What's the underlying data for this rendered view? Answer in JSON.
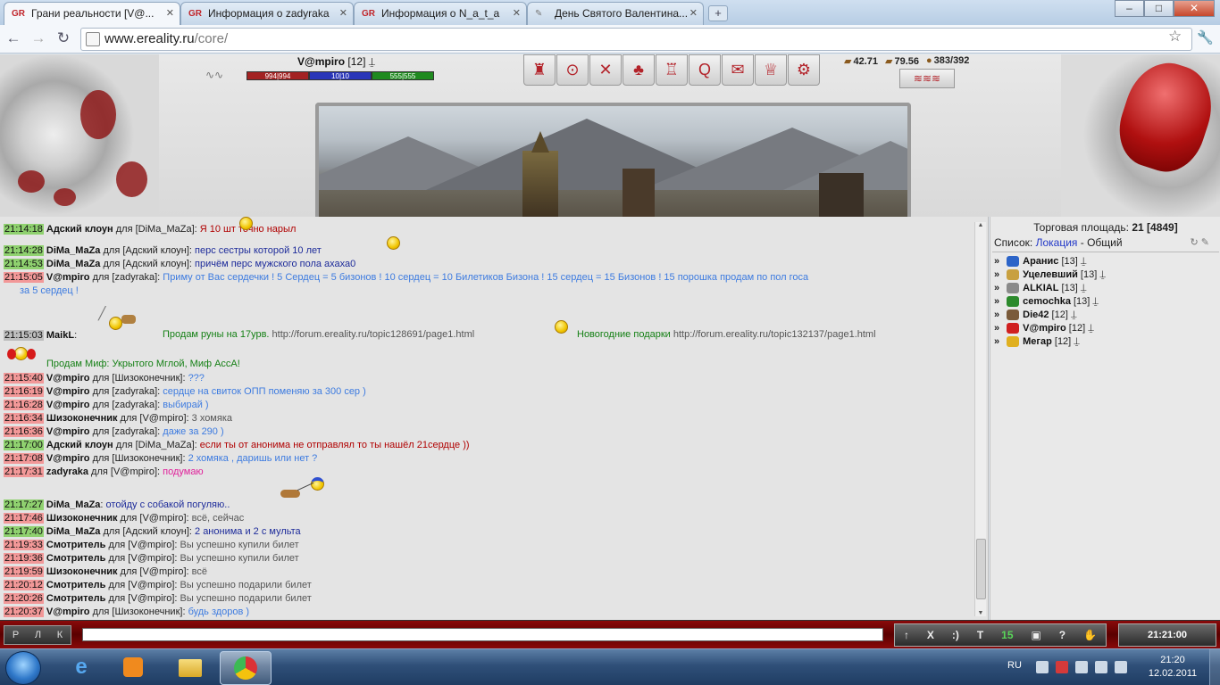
{
  "browser": {
    "tabs": [
      {
        "title": "Грани реальности [V@...",
        "active": true
      },
      {
        "title": "Информация о zadyraka",
        "active": false
      },
      {
        "title": "Информация о N_a_t_a",
        "active": false
      },
      {
        "title": "День Святого Валентина...",
        "active": false
      }
    ],
    "url_host": "www.ereality.ru",
    "url_path": "/core/",
    "win_min": "–",
    "win_max": "□",
    "win_close": "✕"
  },
  "character": {
    "name": "V@mpiro",
    "level": "[12]",
    "hp": "994|994",
    "mana": "10|10",
    "energy": "555|555"
  },
  "money": {
    "a": "42.71",
    "b": "79.56",
    "c": "383/392"
  },
  "chat": [
    {
      "time": "21:14:18",
      "tc": "g",
      "nick": "Адский клоун",
      "for": " для [DiMa_MaZa]: ",
      "text": "Я 10 шт точно нарыл",
      "color": "t-red"
    },
    {
      "time": "21:14:28",
      "tc": "g",
      "nick": "DiMa_MaZa",
      "for": " для [Адский клоун]: ",
      "text": "перс сестры которой 10 лет",
      "color": "t-navy"
    },
    {
      "time": "21:14:53",
      "tc": "g",
      "nick": "DiMa_MaZa",
      "for": " для [Адский клоун]: ",
      "text": "причём перс мужского пола ахаха0",
      "color": "t-navy"
    },
    {
      "time": "21:15:05",
      "tc": "r",
      "nick": "V@mpiro",
      "for": " для [zadyraka]: ",
      "text": "Приму от Вас сердечки ! 5 Сердец = 5 бизонов ! 10 сердец = 10 Билетиков Бизона ! 15 сердец = 15 Бизонов ! 15 порошка продам по пол госа",
      "color": "t-lblue"
    },
    {
      "time": "",
      "tc": "",
      "nick": "",
      "for": "",
      "text": "за 5 сердец !",
      "color": "t-lblue"
    },
    {
      "time": "21:15:03",
      "tc": "y",
      "nick": "MaikL",
      "for": ": ",
      "text": "",
      "color": ""
    },
    {
      "time": "21:15:40",
      "tc": "r",
      "nick": "V@mpiro",
      "for": " для [Шизоконечник]: ",
      "text": "???",
      "color": "t-lblue"
    },
    {
      "time": "21:16:19",
      "tc": "r",
      "nick": "V@mpiro",
      "for": " для [zadyraka]: ",
      "text": "сердце на свиток ОПП поменяю за 300 сер )",
      "color": "t-lblue"
    },
    {
      "time": "21:16:28",
      "tc": "r",
      "nick": "V@mpiro",
      "for": " для [zadyraka]: ",
      "text": "выбирай )",
      "color": "t-lblue"
    },
    {
      "time": "21:16:34",
      "tc": "r",
      "nick": "Шизоконечник",
      "for": " для [V@mpiro]: ",
      "text": "3 хомяка",
      "color": "t-gray"
    },
    {
      "time": "21:16:36",
      "tc": "r",
      "nick": "V@mpiro",
      "for": " для [zadyraka]: ",
      "text": "даже за 290 )",
      "color": "t-lblue"
    },
    {
      "time": "21:17:00",
      "tc": "g",
      "nick": "Адский клоун",
      "for": " для [DiMa_MaZa]: ",
      "text": "если ты от анонима не отправлял то ты нашёл 21сердце ))",
      "color": "t-red"
    },
    {
      "time": "21:17:08",
      "tc": "r",
      "nick": "V@mpiro",
      "for": " для [Шизоконечник]: ",
      "text": "2 хомяка , даришь или нет ?",
      "color": "t-lblue"
    },
    {
      "time": "21:17:31",
      "tc": "r",
      "nick": "zadyraka",
      "for": " для [V@mpiro]: ",
      "text": "подумаю",
      "color": "t-pink"
    },
    {
      "time": "21:17:27",
      "tc": "g",
      "nick": "DiMa_MaZa",
      "for": ": ",
      "text": "отойду с собакой погуляю..",
      "color": "t-navy"
    },
    {
      "time": "21:17:46",
      "tc": "r",
      "nick": "Шизоконечник",
      "for": " для [V@mpiro]: ",
      "text": "всё, сейчас",
      "color": "t-gray"
    },
    {
      "time": "21:17:40",
      "tc": "g",
      "nick": "DiMa_MaZa",
      "for": " для [Адский клоун]: ",
      "text": "2 анонима и 2 с мульта",
      "color": "t-navy"
    },
    {
      "time": "21:19:33",
      "tc": "r",
      "nick": "Смотритель",
      "for": " для [V@mpiro]: ",
      "text": "Вы успешно купили билет",
      "color": "t-gray"
    },
    {
      "time": "21:19:36",
      "tc": "r",
      "nick": "Смотритель",
      "for": " для [V@mpiro]: ",
      "text": "Вы успешно купили билет",
      "color": "t-gray"
    },
    {
      "time": "21:19:59",
      "tc": "r",
      "nick": "Шизоконечник",
      "for": " для [V@mpiro]: ",
      "text": "всё",
      "color": "t-gray"
    },
    {
      "time": "21:20:12",
      "tc": "r",
      "nick": "Смотритель",
      "for": " для [V@mpiro]: ",
      "text": "Вы успешно подарили билет",
      "color": "t-gray"
    },
    {
      "time": "21:20:26",
      "tc": "r",
      "nick": "Смотритель",
      "for": " для [V@mpiro]: ",
      "text": "Вы успешно подарили билет",
      "color": "t-gray"
    },
    {
      "time": "21:20:37",
      "tc": "r",
      "nick": "V@mpiro",
      "for": " для [Шизоконечник]: ",
      "text": "будь здоров )",
      "color": "t-lblue"
    }
  ],
  "maikl": {
    "part1": "Продам руны на 17урв.",
    "url1": "http://forum.ereality.ru/topic128691/page1.html",
    "part2": "Новогодние подарки",
    "url2": "http://forum.ereality.ru/topic132137/page1.html",
    "part3": "Продам Миф: Укрытого Мглой, Миф АссА!"
  },
  "side": {
    "title_prefix": "Торговая площадь: ",
    "count": "21",
    "total": "[4849]",
    "list_label": "Список: ",
    "loc_link": "Локация",
    "common": " - Общий",
    "users": [
      {
        "name": "Аранис",
        "level": "[13]"
      },
      {
        "name": "Уцелевший",
        "level": "[13]"
      },
      {
        "name": "ALKIAL",
        "level": "[13]"
      },
      {
        "name": "cemochka",
        "level": "[13]"
      },
      {
        "name": "Die42",
        "level": "[12]"
      },
      {
        "name": "V@mpiro",
        "level": "[12]"
      },
      {
        "name": "Мегар",
        "level": "[12]"
      }
    ]
  },
  "bottom": {
    "b1": "Р",
    "b2": "Л",
    "b3": "К",
    "up": "↑",
    "x": "X",
    "smile": ":)",
    "t": "T",
    "count": "15",
    "clock": "21:21:00"
  },
  "taskbar": {
    "lang": "RU",
    "time": "21:20",
    "date": "12.02.2011"
  }
}
